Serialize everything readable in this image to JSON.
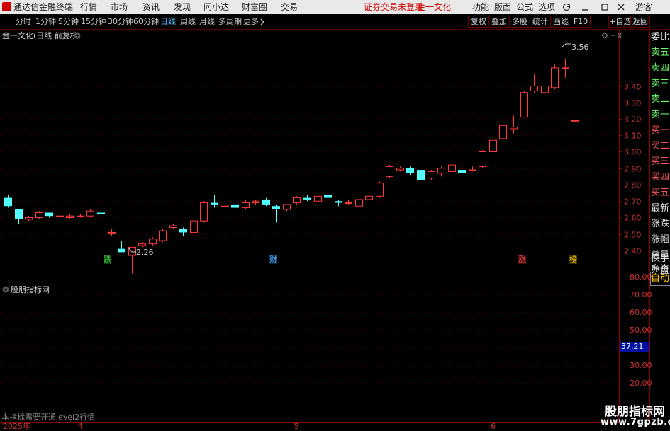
{
  "titlebar": {
    "app_name": "通达信金融终端",
    "menu": [
      "行情",
      "市场",
      "资讯",
      "发现",
      "问小达",
      "财富圈",
      "交易"
    ],
    "notice": "证券交易未登录",
    "stock_name": "金一文化",
    "right_menu": [
      "功能",
      "版面",
      "公式",
      "选项"
    ],
    "guest": "游客"
  },
  "toolbar": {
    "periods": [
      "分时",
      "1分钟",
      "5分钟",
      "15分钟",
      "30分钟",
      "60分钟",
      "日线",
      "周线",
      "月线",
      "多周期",
      "更多"
    ],
    "active_period": "日线",
    "buttons": [
      "复权",
      "叠加",
      "多股",
      "统计",
      "画线",
      "F10",
      "+自选",
      "返回"
    ]
  },
  "main_chart": {
    "title": "金一文化(日线 前复权)",
    "high_label": "3.56",
    "low_label": "2.26",
    "event_markers": [
      {
        "text": "跌",
        "color": "#33cc33"
      },
      {
        "text": "财",
        "color": "#4fa8ff"
      },
      {
        "text": "涨",
        "color": "#ff4444"
      },
      {
        "text": "榜",
        "color": "#ffcc00"
      }
    ]
  },
  "side_panel": {
    "items": [
      "委比",
      "卖五",
      "卖四",
      "卖三",
      "卖二",
      "卖一",
      "买一",
      "买二",
      "买三",
      "买四",
      "买五",
      "最新",
      "涨跌",
      "涨幅",
      "总量",
      "外盘",
      "换手",
      "净资",
      "收益"
    ]
  },
  "sub_chart": {
    "title": "股朋指标网",
    "auto_label": "自动",
    "current_value": "37.21",
    "notice": "本指标需要开通level2行情",
    "y_ticks": [
      "80.00",
      "70.00",
      "60.00",
      "50.00",
      "30.00",
      "20.00"
    ]
  },
  "x_axis": [
    "2025年",
    "4",
    "5",
    "6"
  ],
  "watermark": {
    "line1": "股朋指标网",
    "line2": "www.7gpzb.com"
  },
  "chart_data": {
    "type": "candlestick",
    "title": "金一文化(日线 前复权)",
    "ylim": [
      2.33,
      3.62
    ],
    "yticks": [
      2.4,
      2.5,
      2.6,
      2.7,
      2.8,
      2.9,
      3.0,
      3.1,
      3.2,
      3.3,
      3.4
    ],
    "up_color": "#ff3b3b",
    "down_color": "#54ffff",
    "candles": [
      {
        "o": 2.72,
        "h": 2.74,
        "l": 2.66,
        "c": 2.67
      },
      {
        "o": 2.65,
        "h": 2.65,
        "l": 2.56,
        "c": 2.59
      },
      {
        "o": 2.59,
        "h": 2.61,
        "l": 2.58,
        "c": 2.6
      },
      {
        "o": 2.6,
        "h": 2.64,
        "l": 2.59,
        "c": 2.63
      },
      {
        "o": 2.63,
        "h": 2.63,
        "l": 2.6,
        "c": 2.61
      },
      {
        "o": 2.61,
        "h": 2.62,
        "l": 2.59,
        "c": 2.61
      },
      {
        "o": 2.6,
        "h": 2.62,
        "l": 2.59,
        "c": 2.61
      },
      {
        "o": 2.61,
        "h": 2.62,
        "l": 2.6,
        "c": 2.61
      },
      {
        "o": 2.61,
        "h": 2.65,
        "l": 2.6,
        "c": 2.64
      },
      {
        "o": 2.63,
        "h": 2.64,
        "l": 2.61,
        "c": 2.62
      },
      {
        "o": 2.51,
        "h": 2.53,
        "l": 2.49,
        "c": 2.51
      },
      {
        "o": 2.41,
        "h": 2.46,
        "l": 2.39,
        "c": 2.39
      },
      {
        "o": 2.37,
        "h": 2.42,
        "l": 2.26,
        "c": 2.42
      },
      {
        "o": 2.43,
        "h": 2.45,
        "l": 2.42,
        "c": 2.44
      },
      {
        "o": 2.44,
        "h": 2.48,
        "l": 2.43,
        "c": 2.47
      },
      {
        "o": 2.46,
        "h": 2.53,
        "l": 2.45,
        "c": 2.52
      },
      {
        "o": 2.54,
        "h": 2.56,
        "l": 2.53,
        "c": 2.55
      },
      {
        "o": 2.53,
        "h": 2.54,
        "l": 2.49,
        "c": 2.51
      },
      {
        "o": 2.51,
        "h": 2.59,
        "l": 2.5,
        "c": 2.58
      },
      {
        "o": 2.58,
        "h": 2.7,
        "l": 2.57,
        "c": 2.69
      },
      {
        "o": 2.69,
        "h": 2.74,
        "l": 2.66,
        "c": 2.68
      },
      {
        "o": 2.67,
        "h": 2.69,
        "l": 2.65,
        "c": 2.67
      },
      {
        "o": 2.68,
        "h": 2.69,
        "l": 2.65,
        "c": 2.66
      },
      {
        "o": 2.66,
        "h": 2.71,
        "l": 2.65,
        "c": 2.69
      },
      {
        "o": 2.69,
        "h": 2.71,
        "l": 2.68,
        "c": 2.7
      },
      {
        "o": 2.71,
        "h": 2.72,
        "l": 2.67,
        "c": 2.68
      },
      {
        "o": 2.67,
        "h": 2.68,
        "l": 2.57,
        "c": 2.65
      },
      {
        "o": 2.65,
        "h": 2.68,
        "l": 2.64,
        "c": 2.68
      },
      {
        "o": 2.69,
        "h": 2.73,
        "l": 2.68,
        "c": 2.72
      },
      {
        "o": 2.72,
        "h": 2.74,
        "l": 2.7,
        "c": 2.71
      },
      {
        "o": 2.7,
        "h": 2.74,
        "l": 2.69,
        "c": 2.73
      },
      {
        "o": 2.74,
        "h": 2.77,
        "l": 2.71,
        "c": 2.72
      },
      {
        "o": 2.7,
        "h": 2.71,
        "l": 2.67,
        "c": 2.69
      },
      {
        "o": 2.69,
        "h": 2.71,
        "l": 2.68,
        "c": 2.69
      },
      {
        "o": 2.67,
        "h": 2.72,
        "l": 2.66,
        "c": 2.71
      },
      {
        "o": 2.71,
        "h": 2.74,
        "l": 2.7,
        "c": 2.73
      },
      {
        "o": 2.73,
        "h": 2.82,
        "l": 2.72,
        "c": 2.81
      },
      {
        "o": 2.85,
        "h": 2.92,
        "l": 2.84,
        "c": 2.91
      },
      {
        "o": 2.89,
        "h": 2.91,
        "l": 2.88,
        "c": 2.9
      },
      {
        "o": 2.9,
        "h": 2.91,
        "l": 2.86,
        "c": 2.87
      },
      {
        "o": 2.89,
        "h": 2.89,
        "l": 2.83,
        "c": 2.83
      },
      {
        "o": 2.84,
        "h": 2.89,
        "l": 2.83,
        "c": 2.88
      },
      {
        "o": 2.87,
        "h": 2.91,
        "l": 2.85,
        "c": 2.9
      },
      {
        "o": 2.88,
        "h": 2.93,
        "l": 2.87,
        "c": 2.92
      },
      {
        "o": 2.89,
        "h": 2.89,
        "l": 2.84,
        "c": 2.87
      },
      {
        "o": 2.89,
        "h": 2.91,
        "l": 2.88,
        "c": 2.89
      },
      {
        "o": 2.91,
        "h": 3.01,
        "l": 2.9,
        "c": 3.0
      },
      {
        "o": 3.0,
        "h": 3.09,
        "l": 2.99,
        "c": 3.07
      },
      {
        "o": 3.08,
        "h": 3.17,
        "l": 3.06,
        "c": 3.16
      },
      {
        "o": 3.14,
        "h": 3.22,
        "l": 3.11,
        "c": 3.15
      },
      {
        "o": 3.21,
        "h": 3.37,
        "l": 3.21,
        "c": 3.36
      },
      {
        "o": 3.37,
        "h": 3.47,
        "l": 3.36,
        "c": 3.4
      },
      {
        "o": 3.36,
        "h": 3.42,
        "l": 3.35,
        "c": 3.4
      },
      {
        "o": 3.39,
        "h": 3.53,
        "l": 3.38,
        "c": 3.51
      },
      {
        "o": 3.51,
        "h": 3.56,
        "l": 3.45,
        "c": 3.51
      },
      {
        "o": 3.19,
        "h": 3.19,
        "l": 3.19,
        "c": 3.19
      }
    ]
  }
}
